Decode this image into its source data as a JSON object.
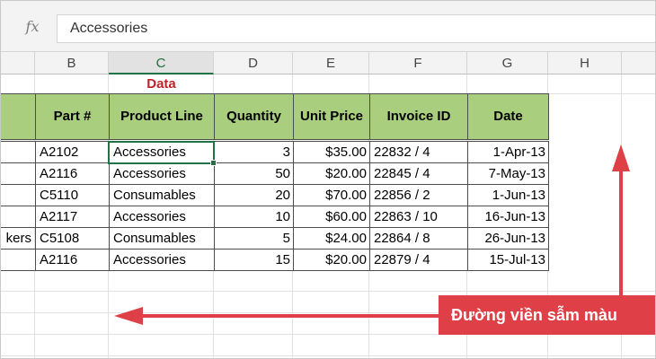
{
  "formula_bar": {
    "fx_label": "fx",
    "value": "Accessories"
  },
  "columns": [
    "B",
    "C",
    "D",
    "E",
    "F",
    "G",
    "H"
  ],
  "selected_column": "C",
  "table_title": "Data",
  "headers": [
    "Part  #",
    "Product Line",
    "Quantity",
    "Unit Price",
    "Invoice ID",
    "Date"
  ],
  "rows": [
    {
      "part": "A2102",
      "line": "Accessories",
      "qty": "3",
      "price": "$35.00",
      "invoice": "22832 / 4",
      "date": "1-Apr-13"
    },
    {
      "part": "A2116",
      "line": "Accessories",
      "qty": "50",
      "price": "$20.00",
      "invoice": "22845 / 4",
      "date": "7-May-13"
    },
    {
      "part": "C5110",
      "line": "Consumables",
      "qty": "20",
      "price": "$70.00",
      "invoice": "22856 / 2",
      "date": "1-Jun-13"
    },
    {
      "part": "A2117",
      "line": "Accessories",
      "qty": "10",
      "price": "$60.00",
      "invoice": "22863 / 10",
      "date": "16-Jun-13"
    },
    {
      "part": "C5108",
      "line": "Consumables",
      "qty": "5",
      "price": "$24.00",
      "invoice": "22864 / 8",
      "date": "26-Jun-13"
    },
    {
      "part": "A2116",
      "line": "Accessories",
      "qty": "15",
      "price": "$20.00",
      "invoice": "22879 / 4",
      "date": "15-Jul-13"
    }
  ],
  "col_a_fragment": "kers",
  "callout": "Đường viền sẫm màu",
  "colors": {
    "header_fill": "#a9cf7e",
    "accent": "#217346",
    "callout": "#df3f46",
    "title_red": "#c0222c"
  }
}
